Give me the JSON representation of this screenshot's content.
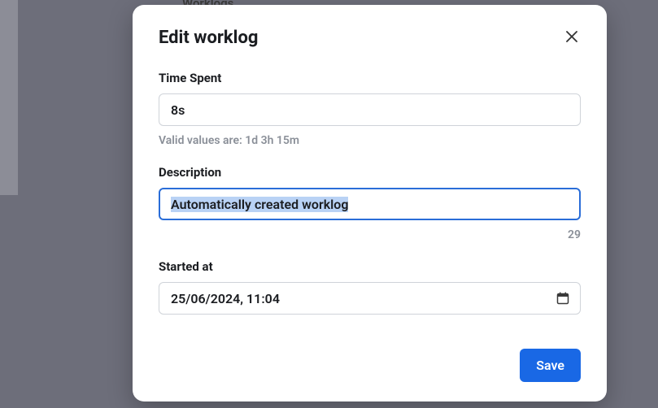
{
  "background": {
    "partial_text": "Worklogs"
  },
  "modal": {
    "title": "Edit worklog",
    "timeSpent": {
      "label": "Time Spent",
      "value": "8s",
      "helper": "Valid values are: 1d 3h 15m"
    },
    "description": {
      "label": "Description",
      "value": "Automatically created worklog",
      "charCount": "29"
    },
    "startedAt": {
      "label": "Started at",
      "value": "25/06/2024, 11:04"
    },
    "saveLabel": "Save"
  }
}
